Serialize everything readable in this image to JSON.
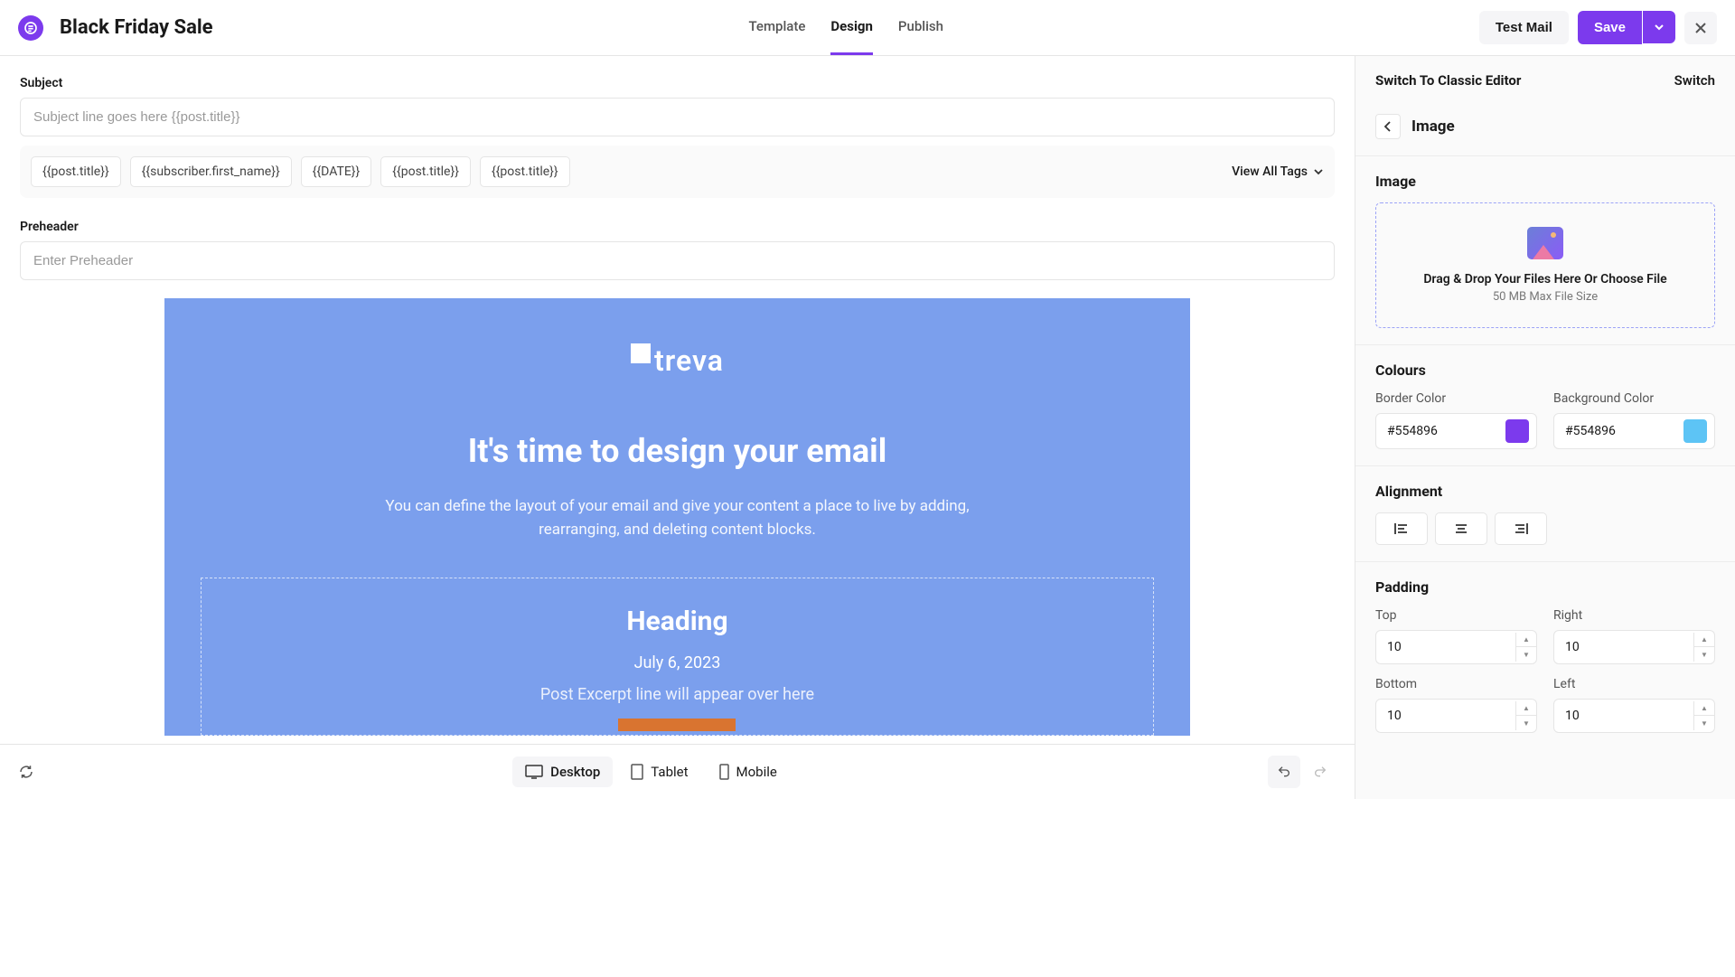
{
  "header": {
    "title": "Black Friday Sale",
    "tabs": [
      {
        "label": "Template"
      },
      {
        "label": "Design"
      },
      {
        "label": "Publish"
      }
    ],
    "active_tab": 1,
    "test_mail": "Test Mail",
    "save": "Save"
  },
  "subject": {
    "label": "Subject",
    "placeholder": "Subject line goes here {{post.title}}",
    "value": "",
    "tags": [
      "{{post.title}}",
      "{{subscriber.first_name}}",
      "{{DATE}}",
      "{{post.title}}",
      "{{post.title}}"
    ],
    "view_all": "View All Tags"
  },
  "preheader": {
    "label": "Preheader",
    "placeholder": "Enter Preheader",
    "value": ""
  },
  "canvas": {
    "logo": "treva",
    "heading": "It's time to design your email",
    "body": "You can define the layout of your email and give your content a place to live by adding, rearranging, and deleting content blocks.",
    "block": {
      "title": "Heading",
      "date": "July 6, 2023",
      "excerpt": "Post Excerpt line will appear over here"
    }
  },
  "toolbar": {
    "devices": [
      {
        "label": "Desktop"
      },
      {
        "label": "Tablet"
      },
      {
        "label": "Mobile"
      }
    ],
    "active_device": 0
  },
  "sidebar": {
    "switch_label": "Switch To Classic Editor",
    "switch_action": "Switch",
    "crumb": "Image",
    "image": {
      "heading": "Image",
      "drop_text": "Drag & Drop Your Files Here Or Choose File",
      "drop_sub": "50 MB Max File Size"
    },
    "colours": {
      "heading": "Colours",
      "border_label": "Border Color",
      "border_value": "#554896",
      "border_swatch": "#7c3aed",
      "bg_label": "Background Color",
      "bg_value": "#554896",
      "bg_swatch": "#5dc4f5"
    },
    "alignment": {
      "heading": "Alignment"
    },
    "padding": {
      "heading": "Padding",
      "top_label": "Top",
      "top_value": "10",
      "right_label": "Right",
      "right_value": "10",
      "bottom_label": "Bottom",
      "bottom_value": "10",
      "left_label": "Left",
      "left_value": "10"
    }
  }
}
